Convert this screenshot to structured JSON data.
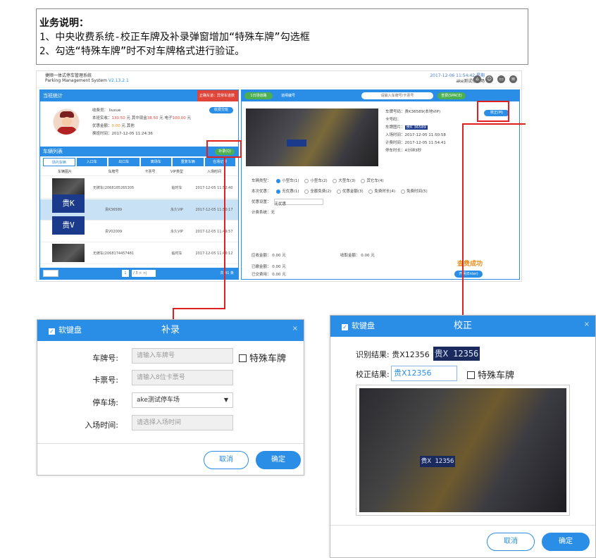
{
  "desc": {
    "title": "业务说明：",
    "line1": "1、中央收费系统-校正车牌及补录弹窗增加“特殊车牌”勾选框",
    "line2": "2、勾选“特殊车牌”时不对车牌格式进行验证。"
  },
  "app": {
    "name_line1": "捷顺一体式停车管理系统",
    "name_line2": "Parking Management System",
    "version": "V2.13.2.1",
    "datetime": "2017-12-06 11:54:42 星期",
    "site": "ake测试停车场",
    "stats": {
      "header": "当班统计",
      "header_red": "正确车道：异常车道数量：",
      "operator": "收费员：  liuxue",
      "income_label": "本班实收：",
      "income_cash": "130.50",
      "income_mid": " 元 其中现金",
      "income_mid2": " 元 电子",
      "income_val2": "38.50",
      "income_val3": "100.00",
      "income_unit": " 元",
      "discount_label": "优惠金额：",
      "discount_val": "0.00",
      "discount_unit": " 元 其他",
      "shift_time": "换班时间：2017-12-05 11:24:36",
      "shift_btn": "收费交班"
    },
    "list": {
      "header": "车辆列表",
      "supplement_btn": "补录(Q)",
      "tabs": [
        "场内车辆",
        "入口车",
        "出口车",
        "离场车",
        "重复车辆",
        "在场记录"
      ],
      "columns": [
        "车辆图片",
        "车牌号",
        "卡票号",
        "VIP类型",
        "入场时间"
      ],
      "rows": [
        {
          "plate": "无牌车(2068185265305",
          "card": "",
          "vip": "临时车",
          "time": "2017-12-05 11:52:40"
        },
        {
          "plate": "贵K36589",
          "card": "",
          "vip": "永久VIP",
          "time": "2017-12-05 11:50:17"
        },
        {
          "plate": "贵V02009",
          "card": "",
          "vip": "永久VIP",
          "time": "2017-12-05 11:49:57"
        },
        {
          "plate": "无牌车(2068174457481",
          "card": "",
          "vip": "临时车",
          "time": "2017-12-05 11:46:12"
        }
      ],
      "thumb_plates": [
        "",
        "贵K 36589",
        "贵V 02009",
        ""
      ],
      "pager_total": "共 41 条",
      "pager_page": "1",
      "pager_of": "/ 3  > >|"
    },
    "right": {
      "lane_label": "1日场道路",
      "tab2": "道闸编号",
      "search_placeholder": "请输入车牌号/卡票号",
      "space_btn": "查费(SPACE)",
      "correct_btn": "校正(M)",
      "plate_no": "车牌号码：贵K36589(本地VIP)",
      "card_no": "卡号码：",
      "plate_pic": "车牌图片：",
      "plate_pic_val": "贵K 36589",
      "in_time": "入场时间：2017-12-05 11:50:58",
      "charge_time": "计费时间：2017-12-05 11:54:41",
      "park_duration": "停车时长：4分钟3秒",
      "vehicle_type": "车辆类型：",
      "vehicle_opts": [
        "小型车(1)",
        "小型车(2)",
        "大型车(3)",
        "其它车(4)"
      ],
      "pay_type": "本次优惠：",
      "pay_opts": [
        "无优惠(1)",
        "全额免费(2)",
        "优惠金额(3)",
        "免费时长(4)",
        "免费时间(5)"
      ],
      "discount_type": "优惠设置：",
      "discount_sel": "无优惠",
      "calc_type": "计费系统：",
      "calc_val": "无",
      "fee_label": "应收金额：",
      "fee_val": "0.00",
      "fee_unit": "元",
      "paid_label": "已缴金额：",
      "paid_val": "0.00",
      "paid_unit": "元",
      "due_label": "已交费用：",
      "due_val": "0.00",
      "due_unit": "元",
      "received_label": "收取金额：",
      "received_val": "0.00",
      "received_unit": "元",
      "success": "查费成功",
      "open_btn": "开闸(Enter)"
    }
  },
  "supplement": {
    "softkb": "软键盘",
    "title": "补录",
    "close": "×",
    "plate_label": "车牌号:",
    "plate_placeholder": "请输入车牌号",
    "special": "特殊车牌",
    "card_label": "卡票号:",
    "card_placeholder": "请输入8位卡票号",
    "lot_label": "停车场:",
    "lot_value": "ake测试停车场",
    "time_label": "入场时间:",
    "time_placeholder": "请选择入场时间",
    "cancel": "取消",
    "ok": "确定"
  },
  "correction": {
    "softkb": "软键盘",
    "title": "校正",
    "close": "×",
    "recog_label": "识别结果:",
    "recog_value": "贵X12356",
    "recog_plate_img": "贵X 12356",
    "correct_label": "校正结果:",
    "correct_value": "贵X12356",
    "special": "特殊车牌",
    "photo_plate": "贵X 12356",
    "cancel": "取消",
    "ok": "确定"
  }
}
